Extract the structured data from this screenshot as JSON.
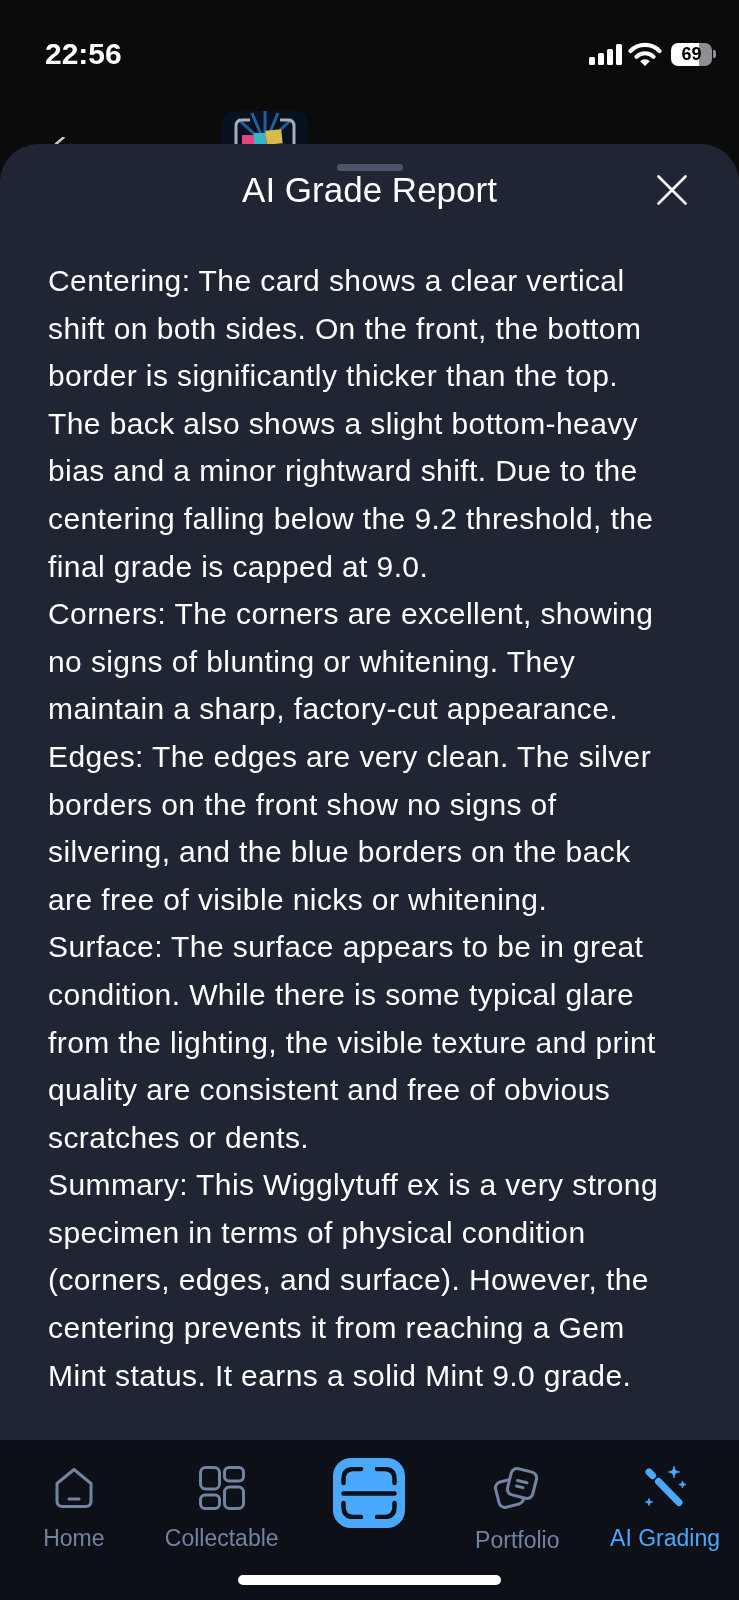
{
  "status_bar": {
    "time": "22:56",
    "battery": "69"
  },
  "sheet": {
    "title": "AI Grade Report",
    "paragraphs": [
      "Centering: The card shows a clear vertical shift on both sides. On the front, the bottom border is significantly thicker than the top. The back also shows a slight bottom-heavy bias and a minor rightward shift. Due to the centering falling below the 9.2 threshold, the final grade is capped at 9.0.",
      "Corners: The corners are excellent, showing no signs of blunting or whitening. They maintain a sharp, factory-cut appearance.",
      "Edges: The edges are very clean. The silver borders on the front show no signs of silvering, and the blue borders on the back are free of visible nicks or whitening.",
      "Surface: The surface appears to be in great condition. While there is some typical glare from the lighting, the visible texture and print quality are consistent and free of obvious scratches or dents.",
      "Summary: This Wigglytuff ex is a very strong specimen in terms of physical condition (corners, edges, and surface). However, the centering prevents it from reaching a Gem Mint status. It earns a solid Mint 9.0 grade."
    ]
  },
  "tab_bar": {
    "items": [
      {
        "kind": "tab",
        "label": "Home",
        "selected": false
      },
      {
        "kind": "tab",
        "label": "Collectable",
        "selected": false
      },
      {
        "kind": "scan",
        "selected": false
      },
      {
        "kind": "tab",
        "label": "Portfolio",
        "selected": false
      },
      {
        "kind": "tab",
        "label": "AI Grading",
        "selected": true
      }
    ]
  }
}
